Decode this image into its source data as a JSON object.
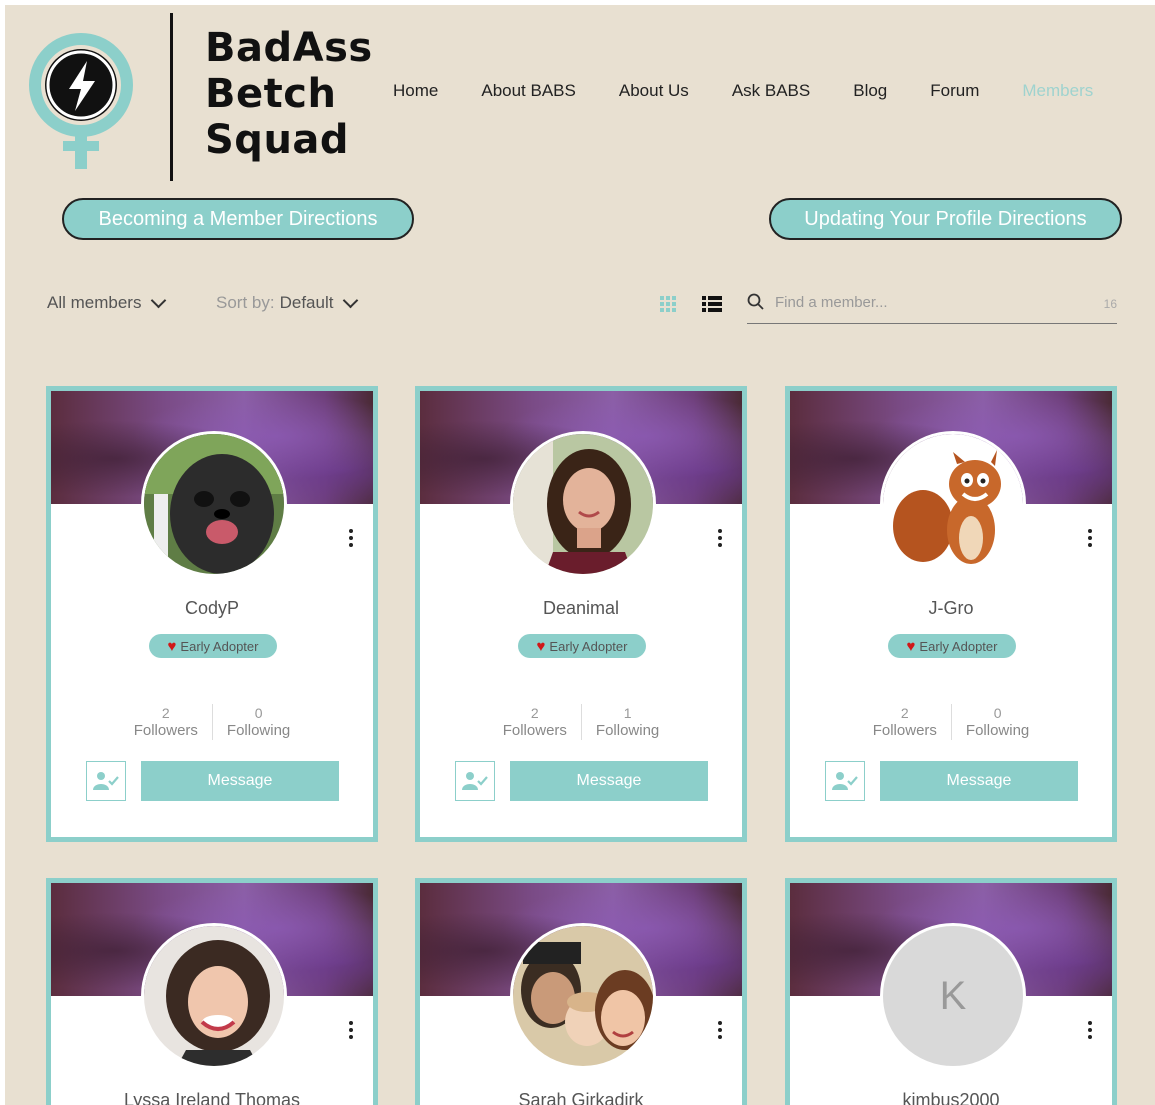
{
  "brand": {
    "line1": "BadAss",
    "line2": "Betch",
    "line3": "Squad"
  },
  "nav": [
    "Home",
    "About BABS",
    "About Us",
    "Ask BABS",
    "Blog",
    "Forum",
    "Members"
  ],
  "buttons": {
    "becoming": "Becoming a Member Directions",
    "updating": "Updating Your Profile Directions"
  },
  "toolbar": {
    "filter": "All members",
    "sort_prefix": "Sort by:",
    "sort_value": "Default",
    "search_placeholder": "Find a member...",
    "count": "16"
  },
  "members": [
    {
      "name": "CodyP",
      "badge": "Early Adopter",
      "followers": "2",
      "following": "0",
      "followers_label": "Followers",
      "following_label": "Following",
      "message": "Message"
    },
    {
      "name": "Deanimal",
      "badge": "Early Adopter",
      "followers": "2",
      "following": "1",
      "followers_label": "Followers",
      "following_label": "Following",
      "message": "Message"
    },
    {
      "name": "J-Gro",
      "badge": "Early Adopter",
      "followers": "2",
      "following": "0",
      "followers_label": "Followers",
      "following_label": "Following",
      "message": "Message"
    },
    {
      "name": "Lyssa Ireland Thomas"
    },
    {
      "name": "Sarah Girkadirk"
    },
    {
      "name": "kimbus2000",
      "initial": "K"
    }
  ],
  "colors": {
    "accent": "#8ccfca",
    "background": "#e8e0d1",
    "heart": "#d01818"
  }
}
